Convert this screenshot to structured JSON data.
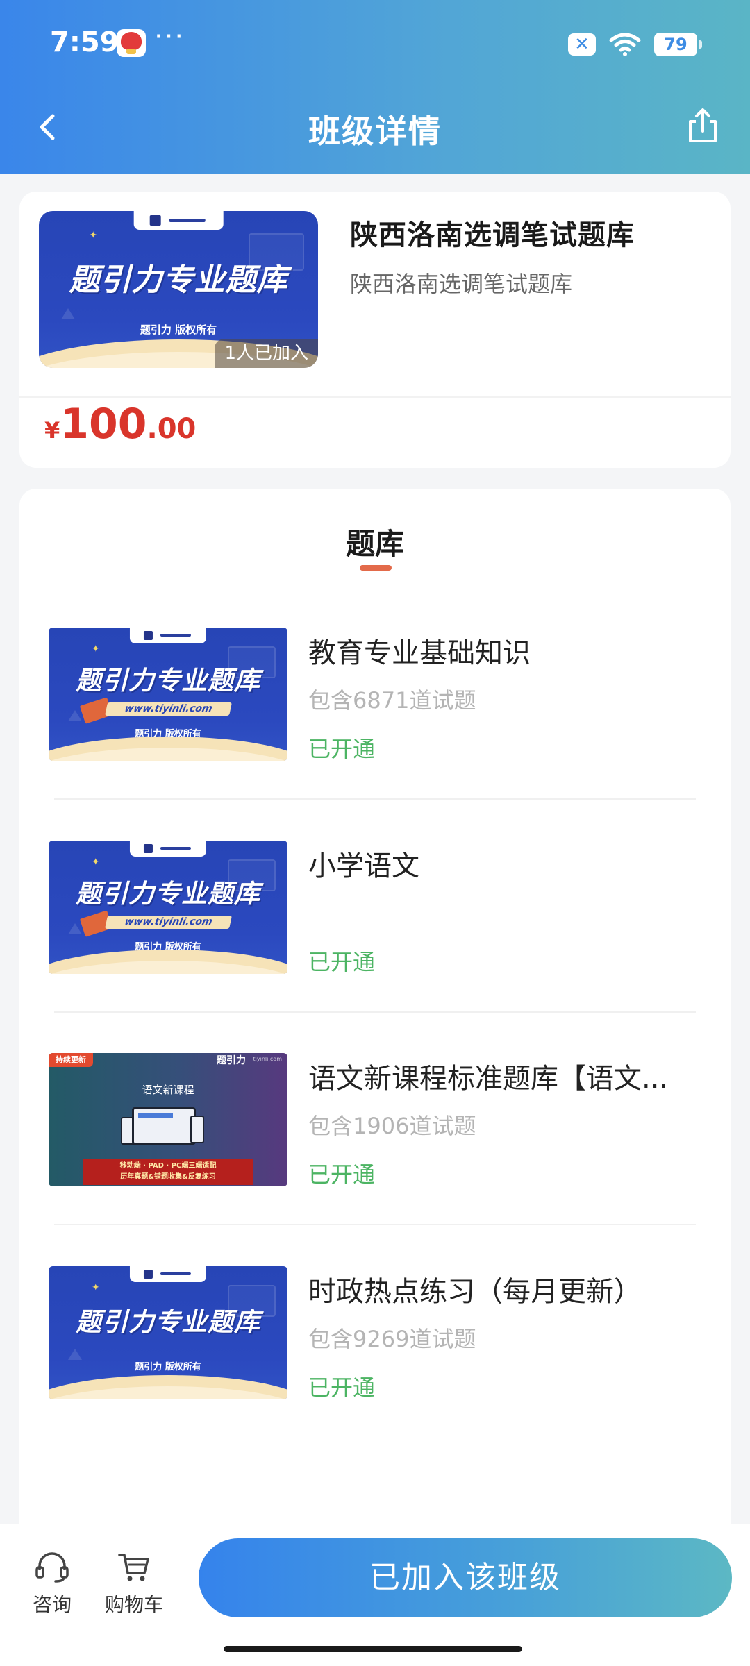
{
  "status_bar": {
    "time": "7:59",
    "dots": "···",
    "battery": "79"
  },
  "nav": {
    "title": "班级详情"
  },
  "class_info": {
    "title": "陕西洛南选调笔试题库",
    "subtitle": "陕西洛南选调笔试题库",
    "cover_headline": "题引力专业题库",
    "cover_copyright": "题引力 版权所有",
    "joined_badge": "1人已加入",
    "price_currency": "¥",
    "price_int": "100",
    "price_dec": ".00"
  },
  "section": {
    "title": "题库"
  },
  "banks": [
    {
      "name": "教育专业基础知识",
      "count": "包含6871道试题",
      "status": "已开通",
      "cover_headline": "题引力专业题库",
      "cover_url": "www.tiyinli.com",
      "cover_copyright": "题引力 版权所有"
    },
    {
      "name": "小学语文",
      "count": "",
      "status": "已开通",
      "cover_headline": "题引力专业题库",
      "cover_url": "www.tiyinli.com",
      "cover_copyright": "题引力 版权所有"
    },
    {
      "name": "语文新课程标准题库【语文...",
      "count": "包含1906道试题",
      "status": "已开通",
      "cover_tag": "持续更新",
      "cover_logo": "题引力",
      "cover_site": "tiyinli.com",
      "cover_course": "语文新课程",
      "cover_banner_line1": "移动端 · PAD · PC端三端适配",
      "cover_banner_line2": "历年真题&错题收集&反复练习"
    },
    {
      "name": "时政热点练习（每月更新）",
      "count": "包含9269道试题",
      "status": "已开通",
      "cover_headline": "题引力专业题库",
      "cover_copyright": "题引力 版权所有"
    }
  ],
  "bottom_bar": {
    "consult_label": "咨询",
    "cart_label": "购物车",
    "join_label": "已加入该班级"
  },
  "colors": {
    "header_gradient_start": "#3a86ea",
    "header_gradient_end": "#5ab5c6",
    "price_red": "#d9352b",
    "status_green": "#4cb463",
    "underline_orange": "#e36a4a",
    "cover_blue": "#2745b6"
  },
  "icons": {
    "back": "chevron-left-icon",
    "share": "share-icon",
    "consult": "headset-icon",
    "cart": "cart-icon",
    "wifi": "wifi-icon"
  }
}
